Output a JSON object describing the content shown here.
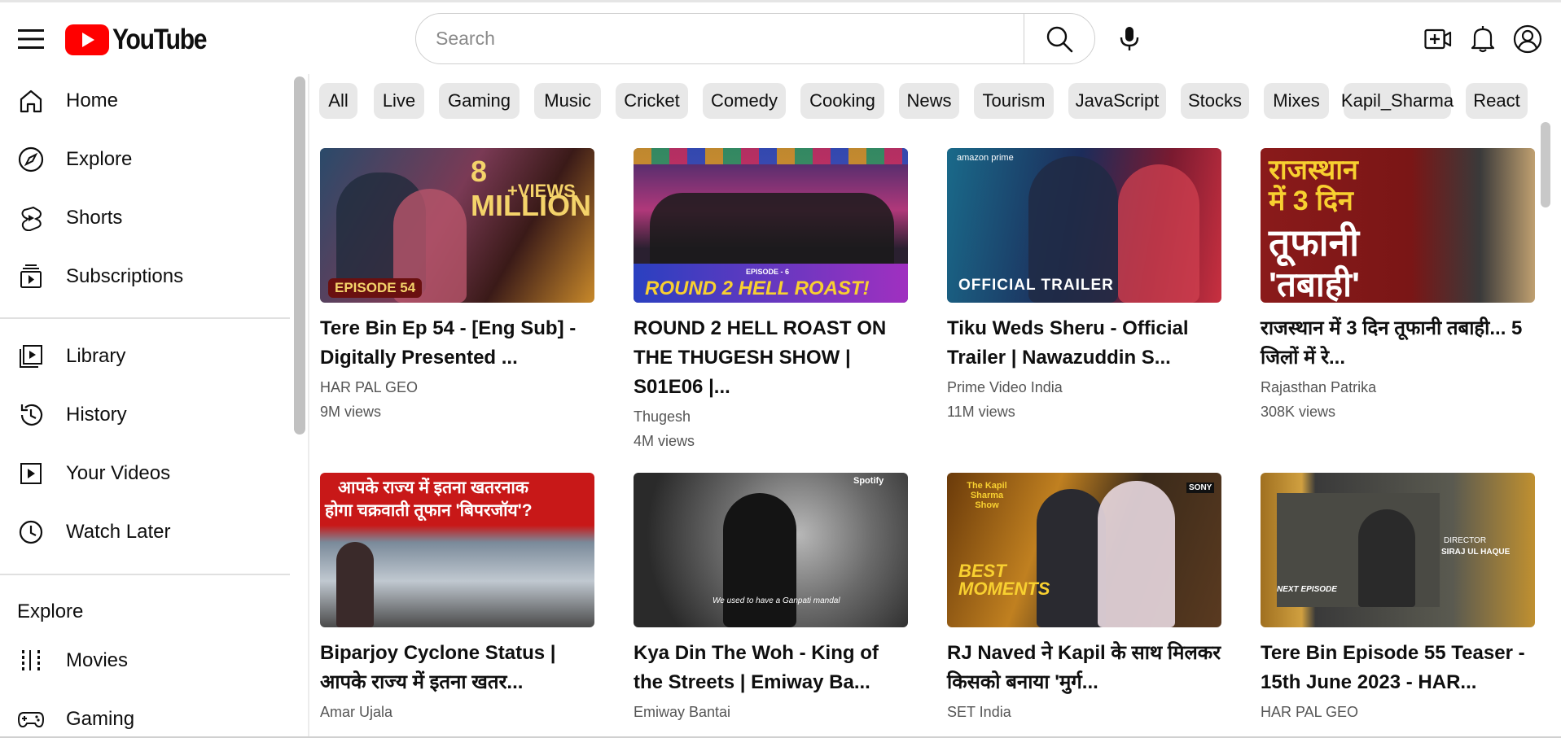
{
  "header": {
    "logo_text": "YouTube",
    "search_placeholder": "Search"
  },
  "sidebar": {
    "items_main": [
      {
        "label": "Home",
        "icon": "home-icon"
      },
      {
        "label": "Explore",
        "icon": "compass-icon"
      },
      {
        "label": "Shorts",
        "icon": "shorts-icon"
      },
      {
        "label": "Subscriptions",
        "icon": "subscriptions-icon"
      }
    ],
    "items_library": [
      {
        "label": "Library",
        "icon": "library-icon"
      },
      {
        "label": "History",
        "icon": "history-icon"
      },
      {
        "label": "Your Videos",
        "icon": "your-videos-icon"
      },
      {
        "label": "Watch Later",
        "icon": "clock-icon"
      }
    ],
    "explore_heading": "Explore",
    "items_explore": [
      {
        "label": "Movies",
        "icon": "film-icon"
      },
      {
        "label": "Gaming",
        "icon": "gamepad-icon"
      }
    ]
  },
  "chips": [
    "All",
    "Live",
    "Gaming",
    "Music",
    "Cricket",
    "Comedy",
    "Cooking",
    "News",
    "Tourism",
    "JavaScript",
    "Stocks",
    "Mixes",
    "Kapil_Sharma",
    "React"
  ],
  "videos": [
    {
      "title": "Tere Bin Ep 54 - [Eng Sub] - Digitally Presented ...",
      "channel": "HAR PAL GEO",
      "views": "9M views",
      "thumb_text": [
        "8 MILLION",
        "+VIEWS",
        "EPISODE 54"
      ]
    },
    {
      "title": "ROUND 2 HELL ROAST ON THE THUGESH SHOW | S01E06 |...",
      "channel": "Thugesh",
      "views": "4M views",
      "thumb_text": [
        "EPISODE - 6",
        "ROUND 2 HELL ROAST!"
      ]
    },
    {
      "title": "Tiku Weds Sheru - Official Trailer | Nawazuddin S...",
      "channel": "Prime Video India",
      "views": "11M views",
      "thumb_text": [
        "amazon prime",
        "OFFICIAL TRAILER"
      ]
    },
    {
      "title": "राजस्थान में 3 दिन तूफानी तबाही... 5 जिलों में रे...",
      "channel": "Rajasthan Patrika",
      "views": "308K views",
      "thumb_text": [
        "राजस्थान",
        "में 3 दिन",
        "तूफानी",
        "'तबाही'"
      ]
    },
    {
      "title": "Biparjoy Cyclone Status | आपके राज्य में इतना खतर...",
      "channel": "Amar Ujala",
      "views": "",
      "thumb_text": [
        "आपके राज्य में इतना खतरनाक",
        "होगा चक्रवाती तूफान 'बिपरजॉय'?"
      ]
    },
    {
      "title": "Kya Din The Woh - King of the Streets | Emiway Ba...",
      "channel": "Emiway Bantai",
      "views": "",
      "thumb_text": [
        "Spotify",
        "We used to have a Ganpati mandal"
      ]
    },
    {
      "title": "RJ Naved ने Kapil के साथ मिलकर किसको बनाया 'मुर्ग...",
      "channel": "SET India",
      "views": "",
      "thumb_text": [
        "The Kapil Sharma Show",
        "BEST MOMENTS",
        "SONY"
      ]
    },
    {
      "title": "Tere Bin Episode 55 Teaser - 15th June 2023 - HAR...",
      "channel": "HAR PAL GEO",
      "views": "",
      "thumb_text": [
        "DIRECTOR",
        "SIRAJ UL HAQUE",
        "NEXT EPISODE"
      ]
    }
  ],
  "colors": {
    "brand_red": "#ff0000",
    "chip_bg": "#e8e8e8",
    "meta_text": "#555555"
  }
}
